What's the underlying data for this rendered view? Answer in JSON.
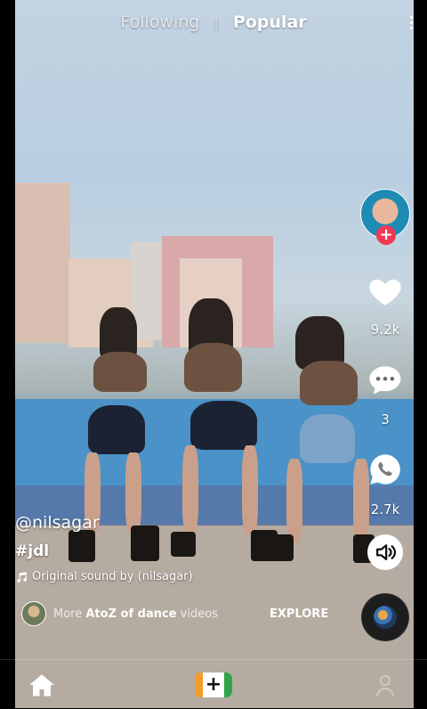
{
  "top_nav": {
    "following_label": "Following",
    "separator": "|",
    "popular_label": "Popular"
  },
  "creator": {
    "username": "@nilsagar",
    "hashtag": "#jdl",
    "sound_text": "Original sound by (nilsagar)"
  },
  "actions": {
    "likes": "9.2k",
    "comments": "3",
    "shares": "2.7k"
  },
  "explore": {
    "prefix": "More",
    "category": "AtoZ of dance",
    "suffix": "videos",
    "link_label": "EXPLORE"
  },
  "colors": {
    "follow_plus": "#f03a54",
    "create_left": "#f59b29",
    "create_right": "#2ea347"
  },
  "icons": [
    "more-vertical-icon",
    "heart-icon",
    "comment-icon",
    "whatsapp-icon",
    "speaker-icon",
    "music-note-icon",
    "home-icon",
    "create-plus-icon",
    "profile-icon"
  ]
}
